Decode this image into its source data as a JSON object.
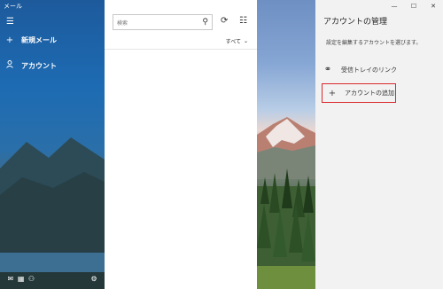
{
  "window": {
    "title": "メール",
    "minimize": "—",
    "maximize": "☐",
    "close": "✕"
  },
  "nav": {
    "menu_icon": "hamburger-icon",
    "new_mail": "新規メール",
    "accounts": "アカウント",
    "bottom_icons": [
      "mail-icon",
      "calendar-icon",
      "people-icon",
      "settings-icon"
    ]
  },
  "list": {
    "search_placeholder": "検索",
    "filter_label": "すべて"
  },
  "account_panel": {
    "title": "アカウントの管理",
    "description": "設定を編集するアカウントを選びます。",
    "link_inboxes": "受信トレイのリンク",
    "add_account": "アカウントの追加"
  },
  "colors": {
    "nav_blue": "#1d6bb3",
    "highlight_red": "#d9282c",
    "panel_bg": "#f2f2f2"
  }
}
